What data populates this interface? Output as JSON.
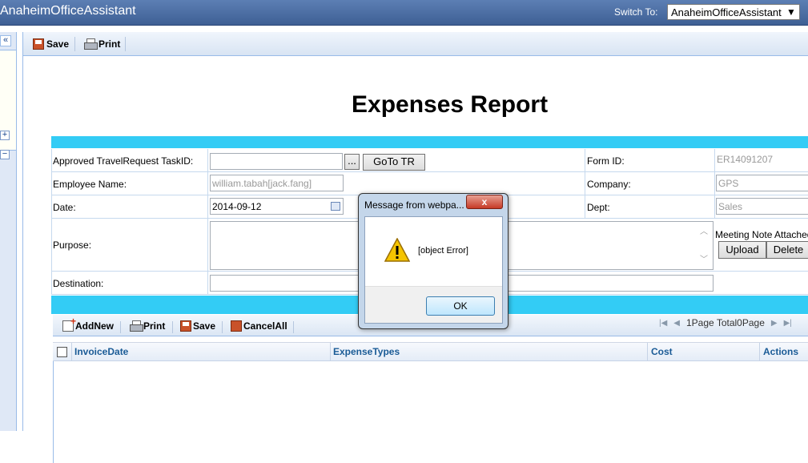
{
  "header": {
    "app_title": "AnaheimOfficeAssistant",
    "switch_label": "Switch To:",
    "switch_value": "AnaheimOfficeAssistant"
  },
  "left_panel": {
    "collapse": "«",
    "expand": "+",
    "minus": "−"
  },
  "toolbar": {
    "save_label": "Save",
    "print_label": "Print"
  },
  "report": {
    "title": "Expenses Report"
  },
  "form": {
    "taskid_label": "Approved TravelRequest TaskID:",
    "taskid_value": "",
    "ellipsis_label": "...",
    "goto_label": "GoTo TR",
    "formid_label": "Form ID:",
    "formid_value": "ER14091207",
    "employee_label": "Employee Name:",
    "employee_value": "william.tabah[jack.fang]",
    "company_label": "Company:",
    "company_value": "GPS",
    "date_label": "Date:",
    "date_value": "2014-09-12",
    "dept_label": "Dept:",
    "dept_value": "Sales",
    "purpose_label": "Purpose:",
    "purpose_value": "",
    "meeting_label": "Meeting Note Attached",
    "upload_label": "Upload",
    "delete_label": "Delete",
    "destination_label": "Destination:",
    "destination_value": ""
  },
  "grid": {
    "toolbar": {
      "add_label": "AddNew",
      "print_label": "Print",
      "save_label": "Save",
      "cancel_label": "CancelAll"
    },
    "pager_text": "1Page Total0Page",
    "columns": [
      "InvoiceDate",
      "ExpenseTypes",
      "Cost",
      "Actions"
    ]
  },
  "dialog": {
    "title": "Message from webpa...",
    "close_label": "x",
    "message": "[object Error]",
    "ok_label": "OK"
  }
}
